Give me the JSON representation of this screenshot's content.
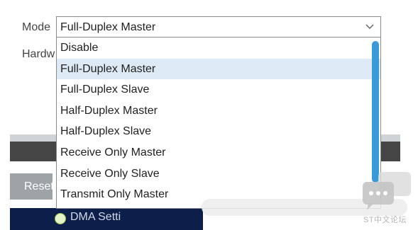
{
  "form": {
    "mode_label": "Mode",
    "hardware_label_partial": "Hardw"
  },
  "mode_select": {
    "value": "Full-Duplex Master",
    "options": [
      "Disable",
      "Full-Duplex Master",
      "Full-Duplex Slave",
      "Half-Duplex Master",
      "Half-Duplex Slave",
      "Receive Only Master",
      "Receive Only Slave",
      "Transmit Only Master"
    ],
    "highlighted_option": "Full-Duplex Master"
  },
  "buttons": {
    "reset_label": "Reset"
  },
  "bottom": {
    "partial_text": "DMA Setti"
  },
  "watermark": {
    "text": "ST中文论坛"
  },
  "colors": {
    "highlight": "#dde9f4",
    "scrollbar": "#3a9ad9",
    "dark_band": "#454545",
    "bottom_band": "#0c1f4a"
  },
  "icons": [
    "chevron-down-icon",
    "chat-bubble-icon",
    "status-dot-icon"
  ]
}
